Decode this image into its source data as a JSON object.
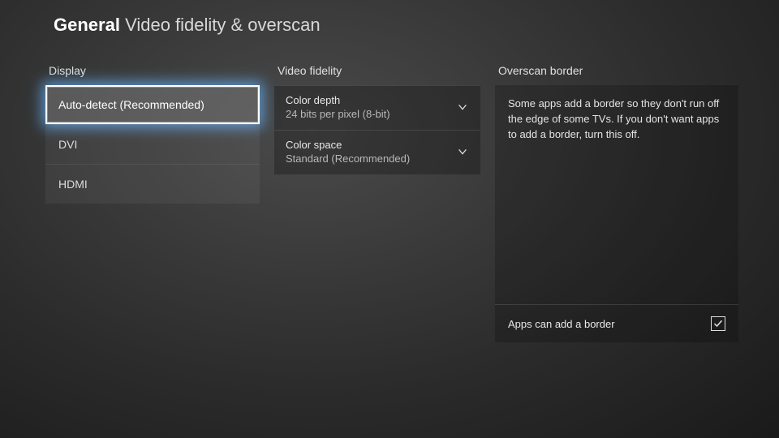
{
  "header": {
    "category": "General",
    "title": "Video fidelity & overscan"
  },
  "display": {
    "label": "Display",
    "items": [
      {
        "label": "Auto-detect (Recommended)",
        "selected": true
      },
      {
        "label": "DVI",
        "selected": false
      },
      {
        "label": "HDMI",
        "selected": false
      }
    ]
  },
  "fidelity": {
    "label": "Video fidelity",
    "color_depth": {
      "label": "Color depth",
      "value": "24 bits per pixel (8-bit)"
    },
    "color_space": {
      "label": "Color space",
      "value": "Standard (Recommended)"
    }
  },
  "overscan": {
    "label": "Overscan border",
    "description": "Some apps add a border so they don't run off the edge of some TVs. If you don't want apps to add a border, turn this off.",
    "checkbox_label": "Apps can add a border",
    "checked": true
  }
}
